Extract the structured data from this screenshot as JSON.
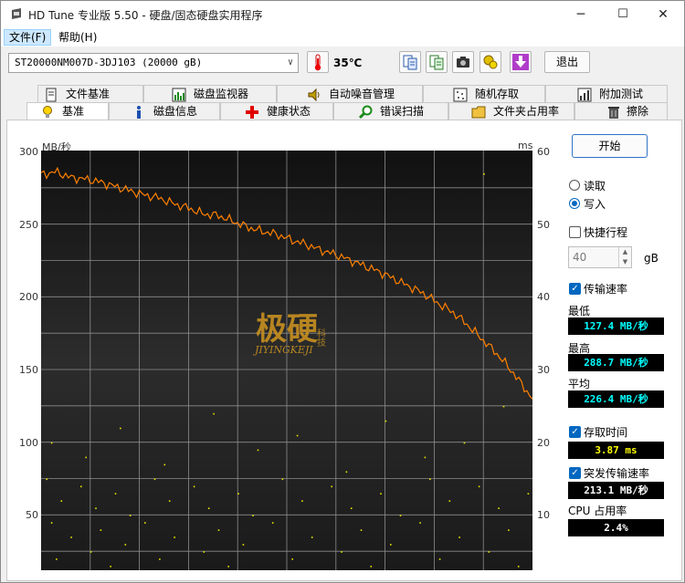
{
  "window": {
    "title": "HD Tune 专业版 5.50 - 硬盘/固态硬盘实用程序",
    "controls": [
      "─",
      "☐",
      "✕"
    ]
  },
  "menu": {
    "file": "文件(F)",
    "help": "帮助(H)"
  },
  "toolbar": {
    "drive": "ST20000NM007D-3DJ103 (20000 gB)",
    "temperature": "35℃",
    "exit_label": "退出",
    "icons": [
      "thermometer-icon",
      "copy-info-icon",
      "copy-info-alt-icon",
      "camera-icon",
      "options-icon",
      "download-icon"
    ]
  },
  "tabs_top": [
    "文件基准",
    "磁盘监视器",
    "自动噪音管理",
    "随机存取",
    "附加测试"
  ],
  "tabs_bottom": [
    "基准",
    "磁盘信息",
    "健康状态",
    "错误扫描",
    "文件夹占用率",
    "擦除"
  ],
  "chart_labels": {
    "left_unit": "MB/秒",
    "right_unit": "ms",
    "left_ticks": [
      "300",
      "250",
      "200",
      "150",
      "100",
      "50"
    ],
    "right_ticks": [
      "60",
      "50",
      "40",
      "30",
      "20",
      "10"
    ],
    "watermark_cn": "极硬",
    "watermark_side": "科技",
    "watermark_en": "JIYINGKEJI"
  },
  "controls": {
    "start_label": "开始",
    "read_label": "读取",
    "write_label": "写入",
    "read_checked": false,
    "write_checked": true,
    "short_stroke_label": "快捷行程",
    "short_stroke_value": "40",
    "short_stroke_unit": "gB",
    "transfer_rate_label": "传输速率"
  },
  "stats": {
    "min_label": "最低",
    "min_value": "127.4 MB/秒",
    "max_label": "最高",
    "max_value": "288.7 MB/秒",
    "avg_label": "平均",
    "avg_value": "226.4 MB/秒",
    "access_label": "存取时间",
    "access_value": "3.87 ms",
    "burst_label": "突发传输速率",
    "burst_value": "213.1 MB/秒",
    "cpu_label": "CPU 占用率",
    "cpu_value": "2.4%"
  },
  "colors": {
    "chart_bg": "#1e1e1e",
    "grid": "#8c8c8c",
    "transfer_line": "#ff8000",
    "access_points": "#e6e600",
    "lcd_bg": "#000000"
  },
  "chart_data": {
    "type": "line",
    "xlim": [
      0,
      100
    ],
    "ylim": [
      0,
      300
    ],
    "y2lim": [
      0,
      60
    ],
    "grid": true,
    "series": [
      {
        "x": [
          0,
          3,
          6,
          9,
          12,
          15,
          18,
          21,
          24,
          27,
          30,
          33,
          36,
          39,
          42,
          45,
          48,
          51,
          54,
          57,
          60,
          63,
          66,
          69,
          72,
          75,
          78,
          81,
          84,
          87,
          90,
          93,
          96,
          100
        ],
        "values": [
          284,
          286,
          282,
          281,
          279,
          276,
          273,
          270,
          268,
          264,
          261,
          257,
          256,
          252,
          248,
          245,
          243,
          239,
          236,
          232,
          229,
          225,
          221,
          217,
          212,
          207,
          202,
          195,
          189,
          180,
          170,
          160,
          148,
          130
        ]
      },
      {
        "x": [
          1,
          2,
          3,
          4,
          6,
          7,
          8,
          10,
          11,
          12,
          14,
          15,
          17,
          18,
          20,
          21,
          23,
          24,
          26,
          27,
          29,
          31,
          33,
          34,
          36,
          38,
          40,
          41,
          43,
          45,
          47,
          49,
          51,
          53,
          55,
          57,
          59,
          61,
          63,
          65,
          67,
          69,
          71,
          73,
          75,
          77,
          79,
          81,
          83,
          85,
          87,
          89,
          91,
          93,
          95,
          97,
          99,
          2,
          9,
          16,
          25,
          35,
          44,
          52,
          62,
          70,
          78,
          86,
          94,
          90
        ],
        "values": [
          15,
          9,
          4,
          12,
          7,
          2,
          14,
          5,
          11,
          8,
          3,
          13,
          6,
          10,
          1,
          9,
          15,
          4,
          12,
          7,
          2,
          14,
          5,
          11,
          8,
          3,
          13,
          6,
          10,
          1,
          9,
          15,
          4,
          12,
          7,
          2,
          14,
          5,
          11,
          8,
          3,
          13,
          6,
          10,
          1,
          9,
          15,
          4,
          12,
          7,
          2,
          14,
          5,
          11,
          8,
          3,
          13,
          20,
          18,
          22,
          17,
          24,
          19,
          21,
          16,
          23,
          18,
          20,
          25,
          57
        ]
      }
    ]
  }
}
